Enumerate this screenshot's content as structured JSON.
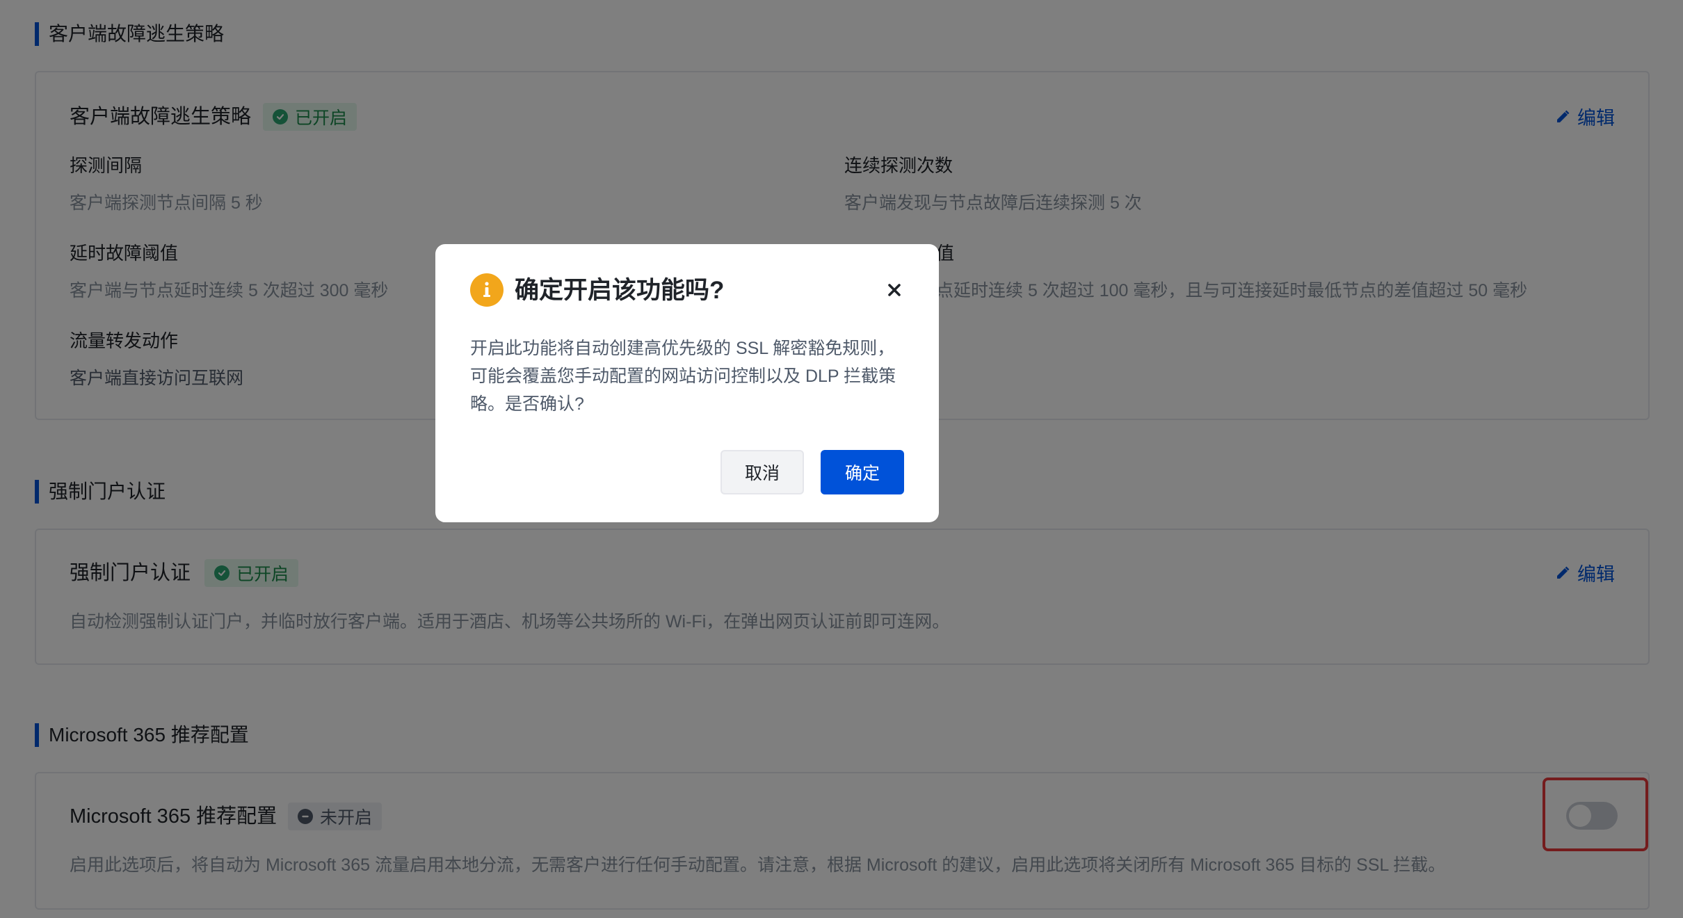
{
  "sections": {
    "failover": {
      "section_title": "客户端故障逃生策略",
      "card_title": "客户端故障逃生策略",
      "status": "已开启",
      "edit_label": "编辑",
      "fields": [
        {
          "label": "探测间隔",
          "value": "客户端探测节点间隔 5 秒"
        },
        {
          "label": "连续探测次数",
          "value": "客户端发现与节点故障后连续探测 5 次"
        },
        {
          "label": "延时故障阈值",
          "value": "客户端与节点延时连续 5 次超过 300 毫秒"
        },
        {
          "label": "值",
          "value": "点延时连续 5 次超过 100 毫秒，且与可连接延时最低节点的差值超过 50 毫秒"
        },
        {
          "label": "流量转发动作",
          "value": "客户端直接访问互联网"
        }
      ]
    },
    "captive": {
      "section_title": "强制门户认证",
      "card_title": "强制门户认证",
      "status": "已开启",
      "edit_label": "编辑",
      "description": "自动检测强制认证门户，并临时放行客户端。适用于酒店、机场等公共场所的 Wi-Fi，在弹出网页认证前即可连网。"
    },
    "m365": {
      "section_title": "Microsoft 365 推荐配置",
      "card_title": "Microsoft 365 推荐配置",
      "status": "未开启",
      "description": "启用此选项后，将自动为 Microsoft 365 流量启用本地分流，无需客户进行任何手动配置。请注意，根据 Microsoft 的建议，启用此选项将关闭所有 Microsoft 365 目标的 SSL 拦截。",
      "toggle_on": false
    }
  },
  "dialog": {
    "title": "确定开启该功能吗?",
    "body": "开启此功能将自动创建高优先级的 SSL 解密豁免规则，可能会覆盖您手动配置的网站访问控制以及 DLP 拦截策略。是否确认?",
    "cancel_label": "取消",
    "confirm_label": "确定"
  },
  "colors": {
    "accent": "#0052d9",
    "success": "#2ba471",
    "warning": "#f2a61b",
    "highlight": "#e8383b"
  },
  "icons": [
    "check-circle-icon",
    "edit-icon",
    "minus-circle-icon",
    "info-icon",
    "close-icon"
  ]
}
